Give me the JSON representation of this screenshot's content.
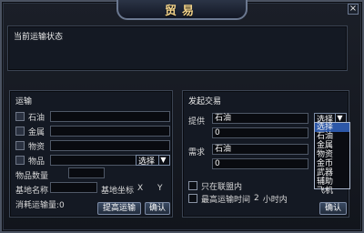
{
  "window": {
    "title": "贸易",
    "close_label": "×"
  },
  "status_section": {
    "title": "当前运输状态"
  },
  "left_panel": {
    "title": "运输",
    "rows": [
      {
        "label": "石油",
        "icon": "oil-icon"
      },
      {
        "label": "金属",
        "icon": "metal-icon"
      },
      {
        "label": "物资",
        "icon": "supplies-icon"
      },
      {
        "label": "物品",
        "icon": "item-icon"
      }
    ],
    "item_select": {
      "value": "选择"
    },
    "item_quantity_label": "物品数量",
    "base_name_label": "基地名称",
    "base_coords_label": "基地坐标",
    "coord_x_label": "X",
    "coord_y_label": "Y",
    "consumption_label": "消耗运输量:",
    "consumption_value": "0",
    "boost_button": "提高运输",
    "confirm_button": "确认"
  },
  "right_panel": {
    "title": "发起交易",
    "offer_label": "提供",
    "offer_resource": "石油",
    "offer_amount": "0",
    "need_label": "需求",
    "need_resource": "石油",
    "need_amount": "0",
    "offer_select": {
      "value": "选择"
    },
    "only_alliance_label": "只在联盟内",
    "max_time_label": "最高运输时间",
    "max_time_value": "2",
    "max_time_unit": "小时内",
    "confirm_button": "确认"
  },
  "dropdown": {
    "items": [
      "选择",
      "石油",
      "金属",
      "物资",
      "金币",
      "武器",
      "辅助",
      "飞机"
    ],
    "selected_index": 0
  },
  "colors": {
    "title": "#f1d28a",
    "dropdown_selected": "#2c57a8"
  }
}
